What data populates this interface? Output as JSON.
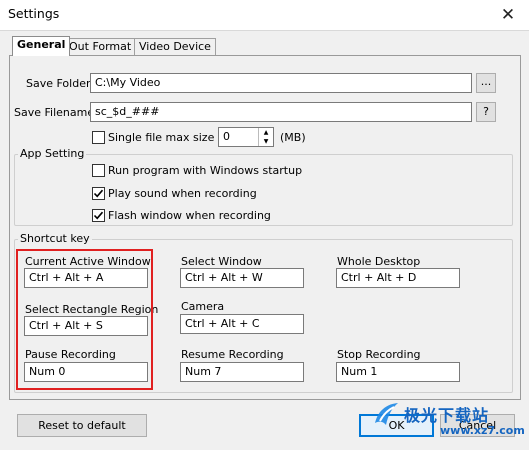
{
  "window": {
    "title": "Settings",
    "close_glyph": "✕"
  },
  "tabs": [
    {
      "label": "General",
      "active": true
    },
    {
      "label": "Out Format",
      "active": false
    },
    {
      "label": "Video Device",
      "active": false
    }
  ],
  "save_folder": {
    "label": "Save Folder:",
    "value": "C:\\My Video",
    "browse_label": "..."
  },
  "save_filename": {
    "label": "Save Filename:",
    "value": "sc_$d_###",
    "help_label": "?"
  },
  "single_file": {
    "label": "Single file max size :",
    "checked": false,
    "value": "0",
    "unit": "(MB)"
  },
  "app_setting": {
    "title": "App Setting",
    "options": [
      {
        "label": "Run program with Windows startup",
        "checked": false
      },
      {
        "label": "Play sound when recording",
        "checked": true
      },
      {
        "label": "Flash window when recording",
        "checked": true
      }
    ]
  },
  "shortcut": {
    "title": "Shortcut key",
    "items": [
      {
        "label": "Current Active Window",
        "value": "Ctrl + Alt + A"
      },
      {
        "label": "Select Window",
        "value": "Ctrl + Alt + W"
      },
      {
        "label": "Whole Desktop",
        "value": "Ctrl + Alt + D"
      },
      {
        "label": "Select Rectangle Region",
        "value": "Ctrl + Alt + S"
      },
      {
        "label": "Camera",
        "value": "Ctrl + Alt + C"
      },
      {
        "label": "Pause Recording",
        "value": "Num 0"
      },
      {
        "label": "Resume Recording",
        "value": "Num 7"
      },
      {
        "label": "Stop Recording",
        "value": "Num 1"
      }
    ]
  },
  "buttons": {
    "reset": "Reset to default",
    "ok": "OK",
    "cancel": "Cancel"
  },
  "watermark": {
    "text": "极光下载站",
    "url": "www.xz7.com"
  },
  "colors": {
    "highlight": "#e02020",
    "focus": "#0078d7"
  }
}
